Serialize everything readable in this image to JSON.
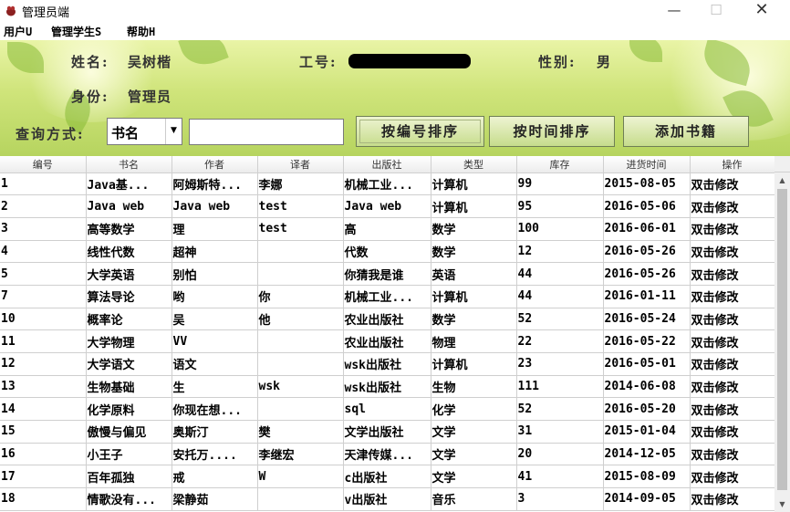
{
  "window": {
    "title": "管理员端",
    "minimize": "—",
    "maximize": "☐",
    "close": "✕"
  },
  "menu": {
    "items": [
      "用户U",
      "管理学生S",
      "帮助H"
    ]
  },
  "info": {
    "name_label": "姓名:",
    "name_value": "吴树楷",
    "id_label": "工号:",
    "gender_label": "性别:",
    "gender_value": "男",
    "role_label": "身份:",
    "role_value": "管理员"
  },
  "query": {
    "label": "查询方式:",
    "select_value": "书名",
    "input_value": "",
    "buttons": {
      "sort_id": "按编号排序",
      "sort_time": "按时间排序",
      "add_book": "添加书籍"
    }
  },
  "table": {
    "columns": [
      "编号",
      "书名",
      "作者",
      "译者",
      "出版社",
      "类型",
      "库存",
      "进货时间",
      "操作"
    ],
    "rows": [
      [
        "1",
        "Java基...",
        "阿姆斯特...",
        "李娜",
        "机械工业...",
        "计算机",
        "99",
        "2015-08-05",
        "双击修改"
      ],
      [
        "2",
        "Java web",
        "Java web",
        "test",
        "Java web",
        "计算机",
        "95",
        "2016-05-06",
        "双击修改"
      ],
      [
        "3",
        "高等数学",
        "理",
        "test",
        "高",
        "数学",
        "100",
        "2016-06-01",
        "双击修改"
      ],
      [
        "4",
        "线性代数",
        "超神",
        "",
        "代数",
        "数学",
        "12",
        "2016-05-26",
        "双击修改"
      ],
      [
        "5",
        "大学英语",
        "别怕",
        "",
        "你猜我是谁",
        "英语",
        "44",
        "2016-05-26",
        "双击修改"
      ],
      [
        "7",
        "算法导论",
        "哟",
        "你",
        "机械工业...",
        "计算机",
        "44",
        "2016-01-11",
        "双击修改"
      ],
      [
        "10",
        "概率论",
        "吴",
        "他",
        "农业出版社",
        "数学",
        "52",
        "2016-05-24",
        "双击修改"
      ],
      [
        "11",
        "大学物理",
        "VV",
        "",
        "农业出版社",
        "物理",
        "22",
        "2016-05-22",
        "双击修改"
      ],
      [
        "12",
        "大学语文",
        "语文",
        "",
        "wsk出版社",
        "计算机",
        "23",
        "2016-05-01",
        "双击修改"
      ],
      [
        "13",
        "生物基础",
        "生",
        "wsk",
        "wsk出版社",
        "生物",
        "111",
        "2014-06-08",
        "双击修改"
      ],
      [
        "14",
        "化学原料",
        "你现在想...",
        "",
        "sql",
        "化学",
        "52",
        "2016-05-20",
        "双击修改"
      ],
      [
        "15",
        "傲慢与偏见",
        "奥斯汀",
        "樊",
        "文学出版社",
        "文学",
        "31",
        "2015-01-04",
        "双击修改"
      ],
      [
        "16",
        "小王子",
        "安托万....",
        "李继宏",
        "天津传媒...",
        "文学",
        "20",
        "2014-12-05",
        "双击修改"
      ],
      [
        "17",
        "百年孤独",
        "戒",
        "W",
        "c出版社",
        "文学",
        "41",
        "2015-08-09",
        "双击修改"
      ],
      [
        "18",
        "情歌没有...",
        "梁静茹",
        "",
        "v出版社",
        "音乐",
        "3",
        "2014-09-05",
        "双击修改"
      ]
    ]
  },
  "scrollbar": {
    "up": "▲",
    "down": "▼"
  }
}
